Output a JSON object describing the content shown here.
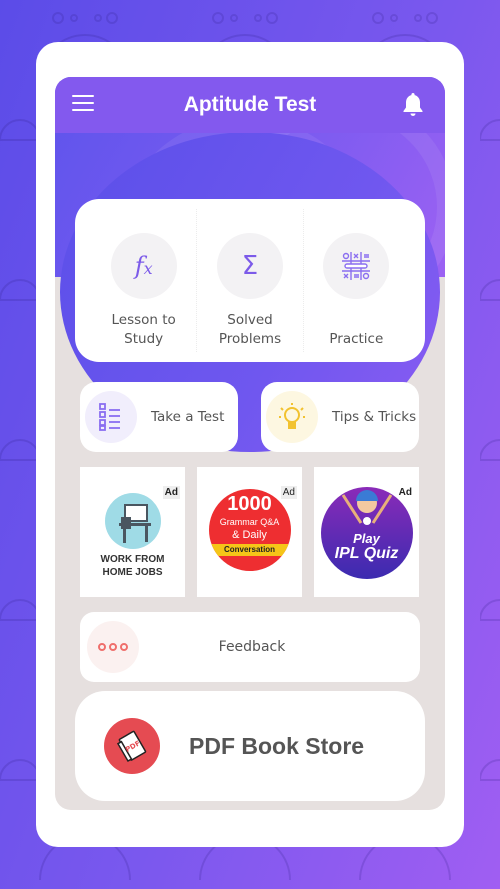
{
  "header": {
    "title": "Aptitude Test",
    "menu_icon": "hamburger-menu-icon",
    "notification_icon": "bell-icon"
  },
  "main_tiles": [
    {
      "label": "Lesson to Study",
      "icon": "function-fx-icon",
      "glyph": "fx"
    },
    {
      "label": "Solved Problems",
      "icon": "sigma-icon",
      "glyph": "Σ"
    },
    {
      "label": "Practice",
      "icon": "tic-tac-toe-pencil-icon",
      "glyph": ""
    }
  ],
  "quick_actions": [
    {
      "label": "Take a Test",
      "icon": "checklist-icon"
    },
    {
      "label": "Tips & Tricks",
      "icon": "lightbulb-icon"
    }
  ],
  "ads": [
    {
      "badge": "Ad",
      "title": "WORK FROM HOME JOBS",
      "line1": "WORK FROM",
      "line2": "HOME JOBS"
    },
    {
      "badge": "Ad",
      "title": "1000 Grammar Q&A & Daily Conversation",
      "num": "1000",
      "line1": "Grammar Q&A",
      "line2": "& Daily",
      "line3": "Conversation"
    },
    {
      "badge": "Ad",
      "title": "Play IPL Quiz",
      "line1": "Play",
      "line2": "IPL Quiz"
    }
  ],
  "feedback": {
    "label": "Feedback",
    "icon": "more-dots-icon"
  },
  "pdf_store": {
    "label": "PDF Book Store",
    "icon": "pdf-book-icon"
  },
  "colors": {
    "header": "#8359ee",
    "accent": "#7c5be9",
    "screen_bg": "#e6e0df",
    "feedback_dots": "#ef6f6c",
    "pdf_red": "#e54b52",
    "tip_yellow": "#f2c230"
  }
}
